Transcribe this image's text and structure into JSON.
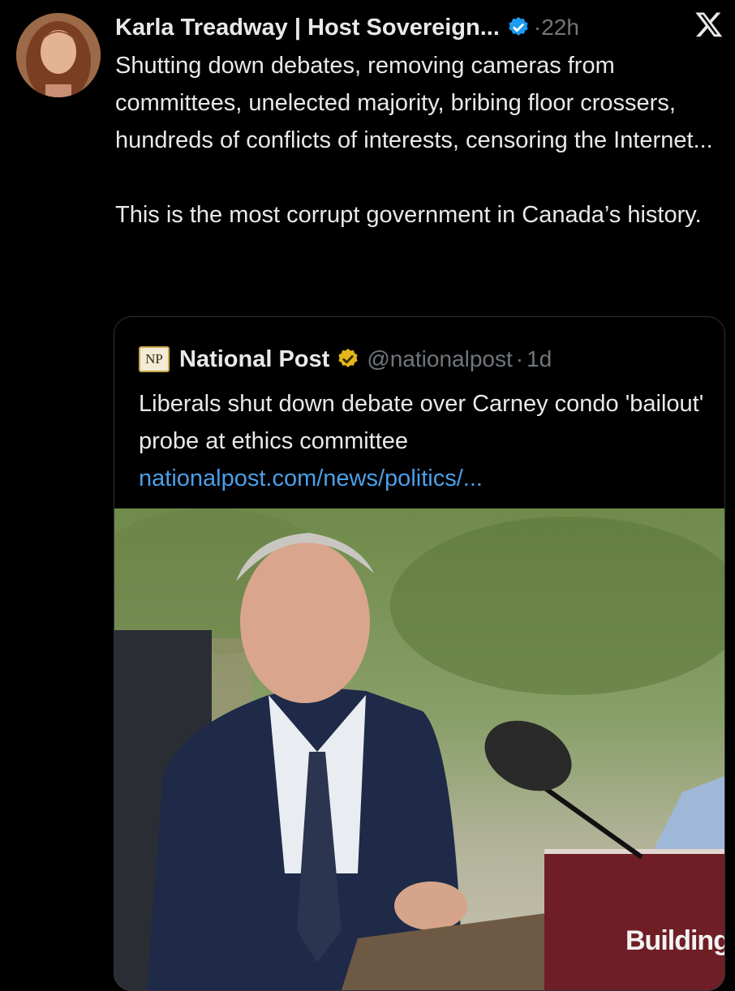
{
  "post": {
    "author_name": "Karla Treadway | Host Sovereign...",
    "verified_icon": "verified-badge-blue",
    "meta_separator": "·",
    "timestamp": "22h",
    "text_paragraphs": [
      "Shutting down debates, removing cameras from committees, unelected majority, bribing floor crossers, hundreds of conflicts of interests, censoring the Internet...",
      "This is the most corrupt government in Canada’s history."
    ]
  },
  "platform_logo": "x-logo",
  "quote": {
    "logo_text": "NP",
    "author_name": "National Post",
    "verified_icon": "verified-badge-gold",
    "handle": "@nationalpost",
    "meta_separator": "·",
    "timestamp": "1d",
    "text": "Liberals shut down debate over Carney condo 'bailout' probe at ethics committee",
    "link": "nationalpost.com/news/politics/...",
    "image_sign_text": "Building"
  },
  "colors": {
    "background": "#000000",
    "text": "#e7e9ea",
    "muted": "#71767b",
    "link": "#4a9fe8",
    "verified_blue": "#1d9bf0",
    "verified_gold": "#e2b719",
    "card_border": "#2f3336"
  }
}
